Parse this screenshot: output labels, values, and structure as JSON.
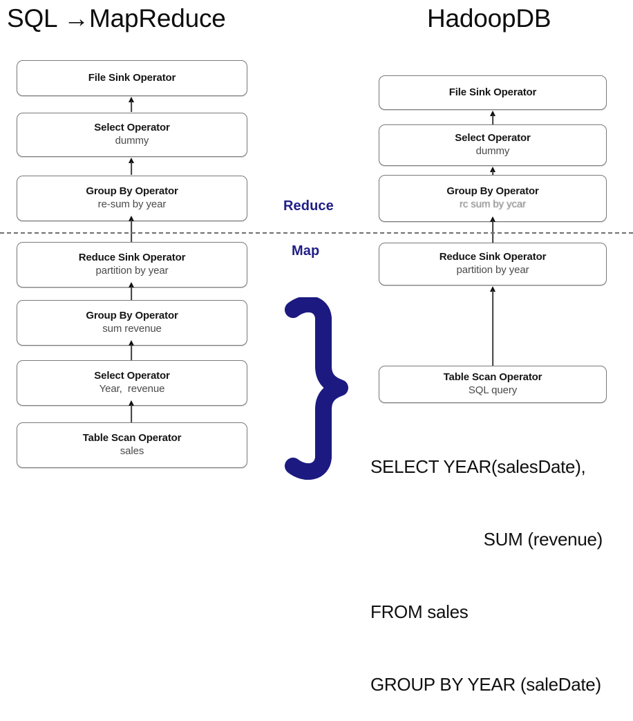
{
  "titles": {
    "left": "SQL →MapReduce",
    "right": "HadoopDB"
  },
  "phase_labels": {
    "reduce": "Reduce",
    "map": "Map",
    "color": "#211e86"
  },
  "colors": {
    "brace": "#1c1a80",
    "phase_text": "#211e86",
    "box_border": "#7a7a7a",
    "box_fill": "#ffffff",
    "arrow": "#0f0f0f",
    "divider": "#6e6e6e",
    "title_text": "#0d0d0d"
  },
  "left_pipeline": {
    "name": "SQL to MapReduce operator tree",
    "boxes": [
      {
        "title": "File Sink Operator",
        "sub": ""
      },
      {
        "title": "Select Operator",
        "sub": "dummy"
      },
      {
        "title": "Group By Operator",
        "sub": "re-sum by year"
      },
      {
        "title": "Reduce Sink Operator",
        "sub": "partition by year"
      },
      {
        "title": "Group By Operator",
        "sub": "sum revenue"
      },
      {
        "title": "Select Operator",
        "sub": "Year,  revenue"
      },
      {
        "title": "Table Scan Operator",
        "sub": "sales"
      }
    ]
  },
  "right_pipeline": {
    "name": "HadoopDB operator tree",
    "boxes": [
      {
        "title": "File Sink Operator",
        "sub": ""
      },
      {
        "title": "Select Operator",
        "sub": "dummy"
      },
      {
        "title": "Group By Operator",
        "sub": "rc sum by ycar"
      },
      {
        "title": "Reduce Sink Operator",
        "sub": "partition by year"
      },
      {
        "title": "Table Scan Operator",
        "sub": "SQL query"
      }
    ]
  },
  "sql_query": {
    "line1": "SELECT YEAR(salesDate),",
    "line2": "SUM (revenue)",
    "line3": "FROM sales",
    "line4": "GROUP BY YEAR (saleDate)"
  },
  "brace": {
    "glyph": "}"
  }
}
